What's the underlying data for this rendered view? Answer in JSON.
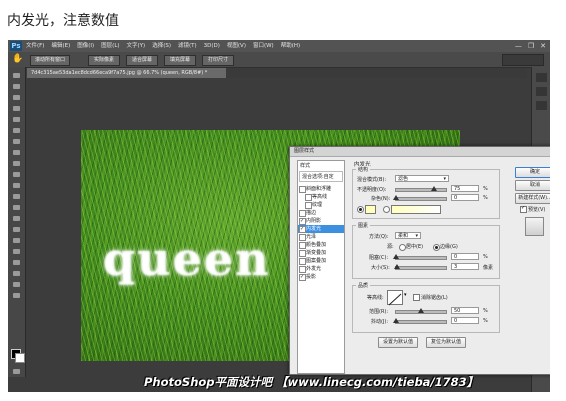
{
  "caption": "内发光，注意数值",
  "menubar": {
    "logo": "Ps",
    "items": [
      "文件(F)",
      "编辑(E)",
      "图像(I)",
      "图层(L)",
      "文字(Y)",
      "选择(S)",
      "滤镜(T)",
      "3D(D)",
      "视图(V)",
      "窗口(W)",
      "帮助(H)"
    ],
    "window_controls": [
      "—",
      "❐",
      "✕"
    ]
  },
  "options_bar": {
    "tool_icon": "hand-icon",
    "buttons": [
      "滚动所有窗口",
      "实际像素",
      "适合屏幕",
      "填充屏幕",
      "打印尺寸"
    ]
  },
  "document_tab": "7d4c315ae53da1ec8dcd66eca9f7a75.jpg @ 66.7% (queen, RGB/8#) *",
  "watermark": "PhotoShop平面设计吧 【www.linecg.com/tieba/1783】",
  "canvas_text": "queen",
  "dialog": {
    "title": "图层样式",
    "styles": {
      "header": "样式",
      "blend": "混合选项:自定",
      "items": [
        {
          "label": "斜面和浮雕",
          "checked": false,
          "selected": false,
          "sub": false
        },
        {
          "label": "等高线",
          "checked": false,
          "selected": false,
          "sub": true
        },
        {
          "label": "纹理",
          "checked": false,
          "selected": false,
          "sub": true
        },
        {
          "label": "描边",
          "checked": false,
          "selected": false,
          "sub": false
        },
        {
          "label": "内阴影",
          "checked": true,
          "selected": false,
          "sub": false
        },
        {
          "label": "内发光",
          "checked": true,
          "selected": true,
          "sub": false
        },
        {
          "label": "光泽",
          "checked": false,
          "selected": false,
          "sub": false
        },
        {
          "label": "颜色叠加",
          "checked": false,
          "selected": false,
          "sub": false
        },
        {
          "label": "渐变叠加",
          "checked": false,
          "selected": false,
          "sub": false
        },
        {
          "label": "图案叠加",
          "checked": false,
          "selected": false,
          "sub": false
        },
        {
          "label": "外发光",
          "checked": false,
          "selected": false,
          "sub": false
        },
        {
          "label": "投影",
          "checked": true,
          "selected": false,
          "sub": false
        }
      ]
    },
    "panel_title": "内发光",
    "structure": {
      "title": "结构",
      "blend_mode_label": "混合模式(B):",
      "blend_mode_value": "滤色",
      "opacity_label": "不透明度(O):",
      "opacity_value": "75",
      "opacity_fraction": 0.75,
      "noise_label": "杂色(N):",
      "noise_value": "0",
      "noise_fraction": 0,
      "percent": "%",
      "glow_color": "#ffffbe"
    },
    "elements": {
      "title": "图素",
      "method_label": "方法(Q):",
      "method_value": "柔和",
      "source_label": "源:",
      "center_label": "居中(E)",
      "edge_label": "边缘(G)",
      "choke_label": "阻塞(C):",
      "choke_value": "0",
      "choke_fraction": 0,
      "size_label": "大小(S):",
      "size_value": "3",
      "size_fraction": 0.012,
      "percent": "%",
      "px": "像素"
    },
    "quality": {
      "title": "品质",
      "contour_label": "等高线:",
      "antialias_label": "消除锯齿(L)",
      "range_label": "范围(R):",
      "range_value": "50",
      "range_fraction": 0.5,
      "jitter_label": "抖动(J):",
      "jitter_value": "0",
      "jitter_fraction": 0,
      "percent": "%"
    },
    "default_button": "设置为默认值",
    "reset_button": "复位为默认值",
    "ok_button": "确定",
    "cancel_button": "取消",
    "new_style_button": "新建样式(W)...",
    "preview_label": "预览(V)"
  }
}
